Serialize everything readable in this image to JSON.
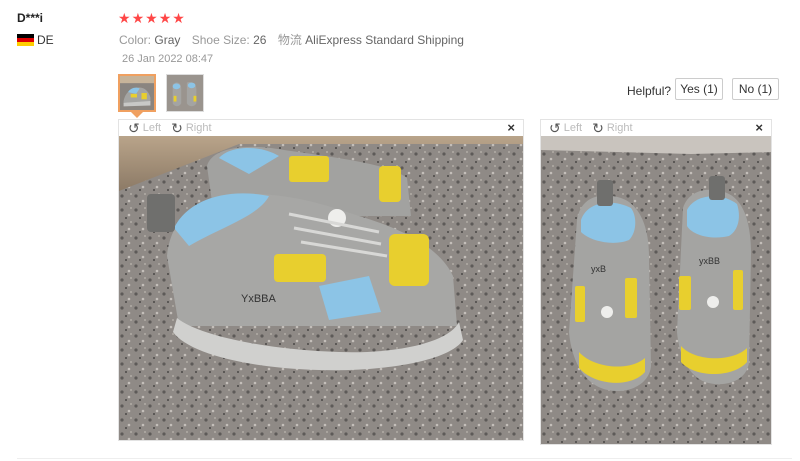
{
  "review": {
    "user": "D***i",
    "country": "DE",
    "rating": 5,
    "stars": [
      "★",
      "★",
      "★",
      "★",
      "★"
    ],
    "color_label": "Color:",
    "color_value": "Gray",
    "size_label": "Shoe Size:",
    "size_value": "26",
    "shipping_label": "物流",
    "shipping_value": "AliExpress Standard Shipping",
    "date": "26 Jan 2022 08:47"
  },
  "helpful": {
    "label": "Helpful?",
    "yes_label": "Yes (1)",
    "no_label": "No (1)"
  },
  "viewer": {
    "left_label": "Left",
    "right_label": "Right",
    "close_symbol": "×"
  },
  "colors": {
    "star": "#ff4747",
    "thumb_active_border": "#f0a060",
    "shoe_gray": "#9a9a98",
    "shoe_blue": "#8cc4e6",
    "shoe_yellow": "#e8cf2e"
  }
}
